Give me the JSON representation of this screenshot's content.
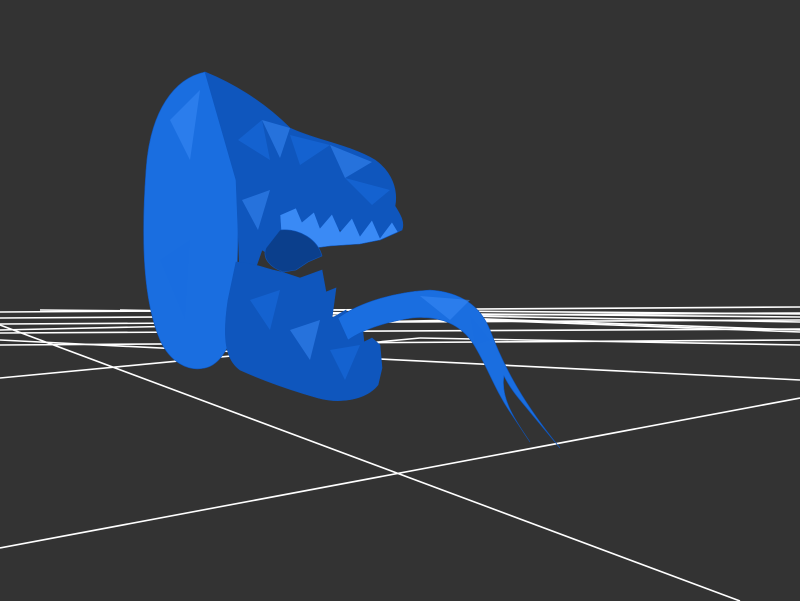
{
  "viewer": {
    "background_color": "#333333",
    "grid_color": "#ffffff",
    "model_color": "#1a6ee0",
    "model_shade_dark": "#0f56bd",
    "model_shade_light": "#3a8af5",
    "model_name": "creature-head-with-tongue",
    "icons": {
      "grid": "floor-grid",
      "model": "mesh-model"
    }
  }
}
